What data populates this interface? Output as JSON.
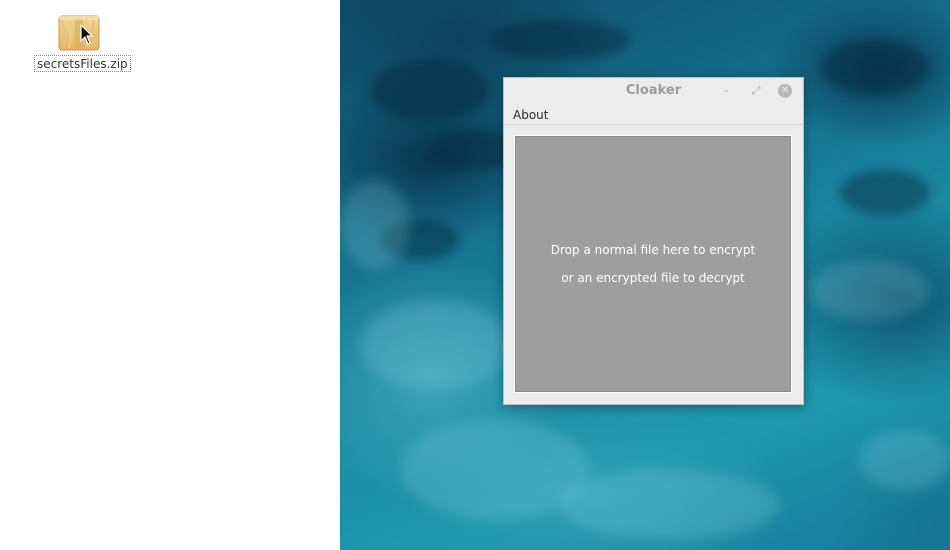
{
  "file_manager": {
    "items": [
      {
        "name": "secretsFiles.zip",
        "icon": "zip-archive-icon"
      }
    ]
  },
  "window": {
    "title": "Cloaker",
    "controls": {
      "minimize": "–",
      "maximize": "⤢",
      "close": "✕"
    },
    "menu": {
      "items": [
        "About"
      ]
    },
    "drop_zone": {
      "line1": "Drop a normal file here to encrypt",
      "line2": "or an encrypted file to decrypt"
    }
  },
  "colors": {
    "drop_zone_bg": "#9e9e9e",
    "window_bg": "#ececec",
    "title_text": "#9a9a9a"
  }
}
